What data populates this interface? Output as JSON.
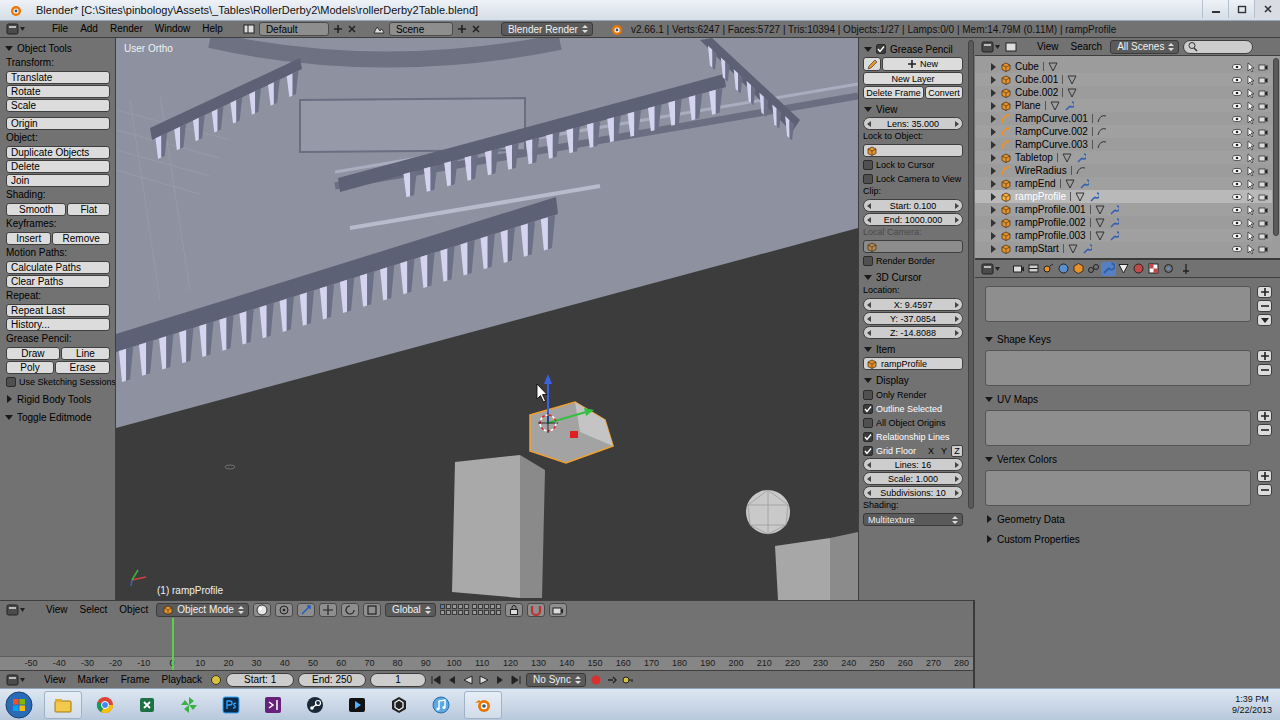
{
  "window": {
    "title": "Blender* [C:\\Sites\\pinbology\\Assets\\_Tables\\RollerDerby2\\Models\\rollerDerby2Table.blend]"
  },
  "info_header": {
    "menus": [
      "File",
      "Add",
      "Render",
      "Window",
      "Help"
    ],
    "layout": "Default",
    "scene": "Scene",
    "engine": "Blender Render",
    "stats": "v2.66.1 | Verts:6247 | Faces:5727 | Tris:10394 | Objects:1/27 | Lamps:0/0 | Mem:14.79M (0.11M) | rampProfile"
  },
  "tool_shelf": {
    "panels": [
      {
        "title": "Object Tools",
        "expanded": true,
        "groups": [
          {
            "label": "Transform:",
            "rows": [
              [
                "Translate"
              ],
              [
                "Rotate"
              ],
              [
                "Scale"
              ]
            ]
          },
          {
            "rows": [
              [
                "Origin"
              ]
            ]
          },
          {
            "label": "Object:",
            "rows": [
              [
                "Duplicate Objects"
              ],
              [
                "Delete"
              ],
              [
                "Join"
              ]
            ]
          },
          {
            "label": "Shading:",
            "rows": [
              [
                "Smooth",
                "Flat"
              ]
            ]
          },
          {
            "label": "Keyframes:",
            "rows": [
              [
                "Insert",
                "Remove"
              ]
            ]
          },
          {
            "label": "Motion Paths:",
            "rows": [
              [
                "Calculate Paths"
              ],
              [
                "Clear Paths"
              ]
            ]
          },
          {
            "label": "Repeat:",
            "rows": [
              [
                "Repeat Last"
              ],
              [
                "History..."
              ]
            ]
          },
          {
            "label": "Grease Pencil:",
            "rows": [
              [
                "Draw",
                "Line"
              ],
              [
                "Poly",
                "Erase"
              ]
            ],
            "checkbox": {
              "label": "Use Sketching Sessions",
              "checked": false
            }
          }
        ]
      },
      {
        "title": "Rigid Body Tools",
        "expanded": false,
        "groups": []
      },
      {
        "title": "Toggle Editmode",
        "expanded": true,
        "groups": []
      }
    ]
  },
  "viewport": {
    "view_name": "User Ortho",
    "object_label": "(1) rampProfile"
  },
  "sidebar": {
    "panels": [
      {
        "title": "Grease Pencil",
        "expanded": true,
        "checked": true,
        "items": [
          {
            "kind": "new_button",
            "text": "New"
          },
          {
            "kind": "buttons",
            "buttons": [
              "New Layer"
            ]
          },
          {
            "kind": "buttons",
            "buttons": [
              "Delete Frame",
              "Convert"
            ]
          }
        ]
      },
      {
        "title": "View",
        "expanded": true,
        "items": [
          {
            "kind": "number",
            "text": "Lens: 35.000"
          },
          {
            "kind": "label",
            "text": "Lock to Object:",
            "disabled": false
          },
          {
            "kind": "object_field",
            "disabled": false
          },
          {
            "kind": "checkbox",
            "text": "Lock to Cursor",
            "checked": false
          },
          {
            "kind": "checkbox",
            "text": "Lock Camera to View",
            "checked": false
          },
          {
            "kind": "label",
            "text": "Clip:",
            "disabled": false
          },
          {
            "kind": "number",
            "text": "Start: 0.100"
          },
          {
            "kind": "number",
            "text": "End: 1000.000"
          },
          {
            "kind": "label",
            "text": "Local Camera:",
            "disabled": true
          },
          {
            "kind": "object_field",
            "disabled": true
          },
          {
            "kind": "checkbox",
            "text": "Render Border",
            "checked": false
          }
        ]
      },
      {
        "title": "3D Cursor",
        "expanded": true,
        "items": [
          {
            "kind": "label",
            "text": "Location:",
            "disabled": false
          },
          {
            "kind": "number",
            "text": "X: 9.4597"
          },
          {
            "kind": "number",
            "text": "Y: -37.0854"
          },
          {
            "kind": "number",
            "text": "Z: -14.8088"
          }
        ]
      },
      {
        "title": "Item",
        "expanded": true,
        "items": [
          {
            "kind": "object_field",
            "text": "rampProfile",
            "disabled": false
          }
        ]
      },
      {
        "title": "Display",
        "expanded": true,
        "items": [
          {
            "kind": "checkbox",
            "text": "Only Render",
            "checked": false
          },
          {
            "kind": "checkbox",
            "text": "Outline Selected",
            "checked": true
          },
          {
            "kind": "checkbox",
            "text": "All Object Origins",
            "checked": false
          },
          {
            "kind": "checkbox",
            "text": "Relationship Lines",
            "checked": true
          },
          {
            "kind": "checkbox",
            "text": "Grid Floor",
            "checked": true,
            "axes": [
              {
                "label": "X",
                "selected": false
              },
              {
                "label": "Y",
                "selected": false
              },
              {
                "label": "Z",
                "selected": true
              }
            ]
          },
          {
            "kind": "number",
            "text": "Lines: 16"
          },
          {
            "kind": "number",
            "text": "Scale: 1.000"
          },
          {
            "kind": "number",
            "text": "Subdivisions: 10"
          },
          {
            "kind": "label",
            "text": "Shading:",
            "disabled": false
          },
          {
            "kind": "dropdown",
            "text": "Multitexture"
          }
        ]
      }
    ]
  },
  "outliner": {
    "menus": [
      "View",
      "Search"
    ],
    "filter": "All Scenes",
    "items": [
      {
        "name": "Cube",
        "kind": "mesh",
        "modifier": false,
        "selected": false
      },
      {
        "name": "Cube.001",
        "kind": "mesh",
        "modifier": false,
        "selected": false
      },
      {
        "name": "Cube.002",
        "kind": "mesh",
        "modifier": false,
        "selected": false
      },
      {
        "name": "Plane",
        "kind": "mesh",
        "modifier": true,
        "selected": false
      },
      {
        "name": "RampCurve.001",
        "kind": "curve",
        "modifier": false,
        "selected": false
      },
      {
        "name": "RampCurve.002",
        "kind": "curve",
        "modifier": false,
        "selected": false
      },
      {
        "name": "RampCurve.003",
        "kind": "curve",
        "modifier": false,
        "selected": false
      },
      {
        "name": "Tabletop",
        "kind": "mesh",
        "modifier": true,
        "selected": false
      },
      {
        "name": "WireRadius",
        "kind": "curve",
        "modifier": false,
        "selected": false
      },
      {
        "name": "rampEnd",
        "kind": "mesh",
        "modifier": true,
        "selected": false
      },
      {
        "name": "rampProfile",
        "kind": "mesh",
        "modifier": true,
        "selected": true
      },
      {
        "name": "rampProfile.001",
        "kind": "mesh",
        "modifier": true,
        "selected": false
      },
      {
        "name": "rampProfile.002",
        "kind": "mesh",
        "modifier": true,
        "selected": false
      },
      {
        "name": "rampProfile.003",
        "kind": "mesh",
        "modifier": true,
        "selected": false
      },
      {
        "name": "rampStart",
        "kind": "mesh",
        "modifier": true,
        "selected": false
      }
    ]
  },
  "properties": {
    "tabs": [
      {
        "selected": false
      },
      {
        "selected": false
      },
      {
        "selected": false
      },
      {
        "selected": false
      },
      {
        "selected": false
      },
      {
        "selected": false
      },
      {
        "selected": true
      },
      {
        "selected": false
      },
      {
        "selected": false
      },
      {
        "selected": false
      },
      {
        "selected": false
      }
    ],
    "panels": [
      {
        "title": "Shape Keys",
        "expanded": true
      },
      {
        "title": "UV Maps",
        "expanded": true
      },
      {
        "title": "Vertex Colors",
        "expanded": true
      },
      {
        "title": "Geometry Data",
        "expanded": false
      },
      {
        "title": "Custom Properties",
        "expanded": false
      }
    ]
  },
  "viewport_header": {
    "menus": [
      "View",
      "Select",
      "Object"
    ],
    "mode": "Object Mode",
    "orientation": "Global",
    "layers": [
      {
        "selected": true
      },
      {
        "selected": false
      },
      {
        "selected": false
      },
      {
        "selected": false
      },
      {
        "selected": false
      },
      {
        "selected": false
      },
      {
        "selected": false
      },
      {
        "selected": false
      },
      {
        "selected": false
      },
      {
        "selected": false
      },
      {
        "selected": false
      },
      {
        "selected": false
      },
      {
        "selected": false
      },
      {
        "selected": false
      },
      {
        "selected": false
      },
      {
        "selected": false
      },
      {
        "selected": false
      },
      {
        "selected": false
      },
      {
        "selected": false
      },
      {
        "selected": false
      }
    ]
  },
  "timeline": {
    "menus": [
      "View",
      "Marker",
      "Frame",
      "Playback"
    ],
    "start": "Start: 1",
    "end": "End: 250",
    "current": "1",
    "sync": "No Sync",
    "ticks": [
      "-50",
      "-40",
      "-30",
      "-20",
      "-10",
      "0",
      "10",
      "20",
      "30",
      "40",
      "50",
      "60",
      "70",
      "80",
      "90",
      "100",
      "110",
      "120",
      "130",
      "140",
      "150",
      "160",
      "170",
      "180",
      "190",
      "200",
      "210",
      "220",
      "230",
      "240",
      "250",
      "260",
      "270",
      "280"
    ]
  },
  "taskbar": {
    "time": "1:39 PM",
    "date": "9/22/2013"
  }
}
